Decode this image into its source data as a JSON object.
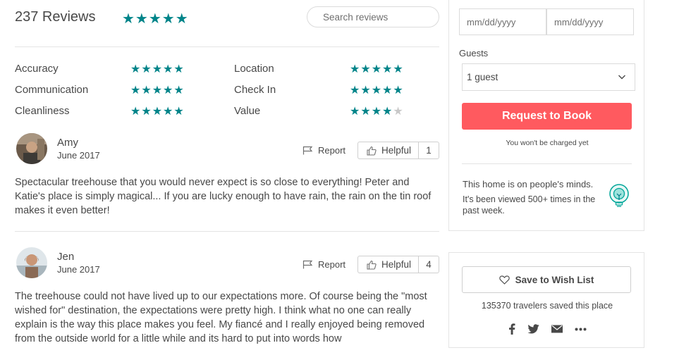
{
  "reviews": {
    "count_label": "237 Reviews",
    "overall_stars": "★★★★★",
    "search_placeholder": "Search reviews"
  },
  "categories": [
    {
      "label": "Accuracy",
      "rating": 5,
      "stars": "★★★★★"
    },
    {
      "label": "Communication",
      "rating": 5,
      "stars": "★★★★★"
    },
    {
      "label": "Cleanliness",
      "rating": 5,
      "stars": "★★★★★"
    },
    {
      "label": "Location",
      "rating": 5,
      "stars": "★★★★★"
    },
    {
      "label": "Check In",
      "rating": 5,
      "stars": "★★★★★"
    },
    {
      "label": "Value",
      "rating": 4.5,
      "stars": "★★★★",
      "partial_star": "★"
    }
  ],
  "review_list": [
    {
      "name": "Amy",
      "date": "June 2017",
      "report_label": "Report",
      "helpful_label": "Helpful",
      "helpful_count": "1",
      "text": "Spectacular treehouse that you would never expect is so close to everything! Peter and Katie's place is simply magical... If you are lucky enough to have rain, the rain on the tin roof makes it even better!"
    },
    {
      "name": "Jen",
      "date": "June 2017",
      "report_label": "Report",
      "helpful_label": "Helpful",
      "helpful_count": "4",
      "text": "The treehouse could not have lived up to our expectations more. Of course being the \"most wished for\" destination, the expectations were pretty high. I think what no one can really explain is the way this place makes you feel. My fiancé and I really enjoyed being removed from the outside world for a little while and its hard to put into words how"
    }
  ],
  "booking": {
    "checkin_placeholder": "mm/dd/yyyy",
    "checkout_placeholder": "mm/dd/yyyy",
    "guests_label": "Guests",
    "guests_value": "1 guest",
    "request_label": "Request to Book",
    "not_charged": "You won't be charged yet",
    "minds_title": "This home is on people's minds.",
    "minds_text": "It's been viewed 500+ times in the past week."
  },
  "wishlist": {
    "save_label": "Save to Wish List",
    "saved_text": "135370 travelers saved this place"
  },
  "share_icons": [
    "facebook-icon",
    "twitter-icon",
    "email-icon",
    "more-icon"
  ],
  "colors": {
    "star_teal": "#008489",
    "book_button": "#ff5a5f",
    "text": "#484848",
    "divider": "#e4e4e4"
  }
}
